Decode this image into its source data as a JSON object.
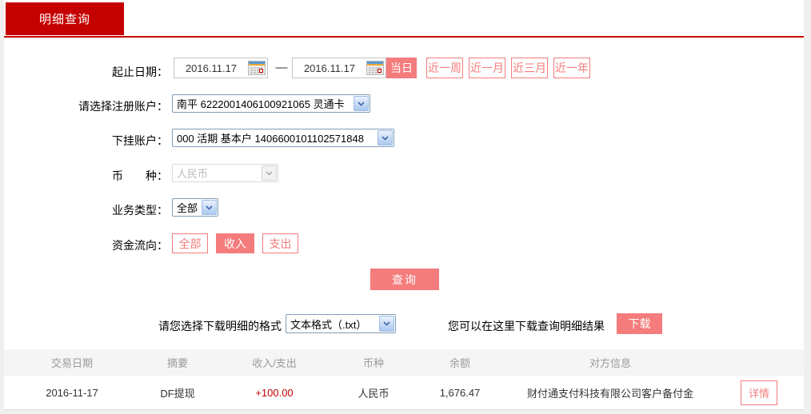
{
  "tab": {
    "label": "明细查询"
  },
  "colors": {
    "primary_red": "#C50000",
    "accent_pink": "#F47C7C",
    "amount_red": "#C00000",
    "header_text_gray": "#9A9A9A"
  },
  "form": {
    "date_label": "起止日期：",
    "date_from": "2016.11.17",
    "date_separator": "—",
    "date_to": "2016.11.17",
    "quick_ranges": [
      "当日",
      "近一周",
      "近一月",
      "近三月",
      "近一年"
    ],
    "quick_range_selected": "当日",
    "registered_account_label": "请选择注册账户：",
    "registered_account_value": "南平 6222001406100921065 灵通卡",
    "sub_account_label": "下挂账户：",
    "sub_account_value": "000 活期 基本户 1406600101102571848",
    "currency_label": "币　　种：",
    "currency_value": "人民币",
    "business_type_label": "业务类型：",
    "business_type_value": "全部",
    "flow_label": "资金流向：",
    "flow_options": [
      "全部",
      "收入",
      "支出"
    ],
    "flow_selected": "收入",
    "query_button": "查询"
  },
  "download": {
    "format_label": "请您选择下载明细的格式",
    "format_value": "文本格式（.txt）",
    "hint": "您可以在这里下载查询明细结果",
    "download_button": "下载"
  },
  "table": {
    "headers": [
      "交易日期",
      "摘要",
      "收入/支出",
      "币种",
      "余额",
      "对方信息"
    ],
    "rows": [
      {
        "date": "2016-11-17",
        "summary": "DF提现",
        "amount": "+100.00",
        "currency": "人民币",
        "balance": "1,676.47",
        "counterparty": "财付通支付科技有限公司客户备付金",
        "detail_button": "详情"
      }
    ]
  }
}
